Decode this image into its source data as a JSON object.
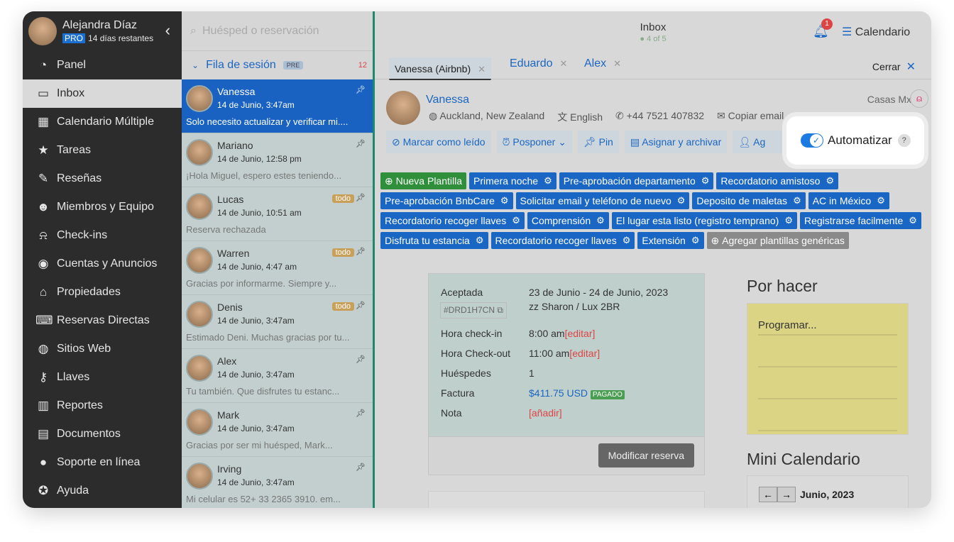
{
  "user": {
    "name": "Alejandra Díaz",
    "plan": "PRO",
    "trial": "14 días restantes"
  },
  "sidebar": {
    "items": [
      {
        "label": "Panel",
        "icon": "dashboard-icon",
        "glyph": "◔"
      },
      {
        "label": "Inbox",
        "icon": "inbox-icon",
        "glyph": "▭"
      },
      {
        "label": "Calendario Múltiple",
        "icon": "calendar-icon",
        "glyph": "▦"
      },
      {
        "label": "Tareas",
        "icon": "star-icon",
        "glyph": "★"
      },
      {
        "label": "Reseñas",
        "icon": "review-icon",
        "glyph": "✎"
      },
      {
        "label": "Miembros y Equipo",
        "icon": "team-icon",
        "glyph": "☻"
      },
      {
        "label": "Check-ins",
        "icon": "bell-icon",
        "glyph": "⍾"
      },
      {
        "label": "Cuentas y Anuncios",
        "icon": "account-icon",
        "glyph": "◉"
      },
      {
        "label": "Propiedades",
        "icon": "home-icon",
        "glyph": "⌂"
      },
      {
        "label": "Reservas Directas",
        "icon": "code-icon",
        "glyph": "⌨"
      },
      {
        "label": "Sitios Web",
        "icon": "globe-icon",
        "glyph": "◍"
      },
      {
        "label": "Llaves",
        "icon": "key-icon",
        "glyph": "⚷"
      },
      {
        "label": "Reportes",
        "icon": "chart-icon",
        "glyph": "▥"
      },
      {
        "label": "Documentos",
        "icon": "document-icon",
        "glyph": "▤"
      },
      {
        "label": "Soporte en línea",
        "icon": "chat-icon",
        "glyph": "●"
      },
      {
        "label": "Ayuda",
        "icon": "help-icon",
        "glyph": "✪"
      }
    ]
  },
  "search": {
    "placeholder": "Huésped o reservación"
  },
  "queue": {
    "label": "Fila de sesión",
    "tag": "PRE",
    "count": "12"
  },
  "conversations": [
    {
      "name": "Vanessa",
      "date": "14 de Junio, 3:47am",
      "preview": "Solo necesito actualizar y verificar mi....",
      "todo": ""
    },
    {
      "name": "Mariano",
      "date": "14 de Junio, 12:58 pm",
      "preview": "¡Hola Miguel, espero estes teniendo...",
      "todo": ""
    },
    {
      "name": "Lucas",
      "date": "14 de Junio, 10:51 am",
      "preview": "Reserva rechazada",
      "todo": "todo"
    },
    {
      "name": "Warren",
      "date": "14 de Junio, 4:47 am",
      "preview": "Gracias por informarme. Siempre y...",
      "todo": "todo"
    },
    {
      "name": "Denis",
      "date": "14 de Junio, 3:47am",
      "preview": "Estimado Deni. Muchas gracias por tu...",
      "todo": "todo"
    },
    {
      "name": "Alex",
      "date": "14 de Junio, 3:47am",
      "preview": "Tu también. Que disfrutes tu estanc...",
      "todo": ""
    },
    {
      "name": "Mark",
      "date": "14 de Junio, 3:47am",
      "preview": "Gracias por ser mi huésped, Mark...",
      "todo": ""
    },
    {
      "name": "Irving",
      "date": "14 de Junio, 3:47am",
      "preview": "Mi celular es 52+ 33 2365 3910. em...",
      "todo": ""
    }
  ],
  "header": {
    "title": "Inbox",
    "agents": "4 of 5",
    "notifications": "1",
    "calendar": "Calendario"
  },
  "tabs": [
    {
      "label": "Vanessa (Airbnb)"
    },
    {
      "label": "Eduardo"
    },
    {
      "label": "Alex"
    }
  ],
  "close_label": "Cerrar",
  "guest": {
    "name": "Vanessa",
    "location": "Auckland, New Zealand",
    "language": "English",
    "phone": "+44 7521 407832",
    "email": "Copiar email",
    "account": "Casas Mx"
  },
  "actions": [
    "Marcar como leído",
    "Posponer",
    "Pin",
    "Asignar y archivar",
    "Ag"
  ],
  "automate": {
    "label": "Automatizar",
    "enabled": true,
    "help": "?"
  },
  "templates": {
    "new": "Nueva Plantilla",
    "items": [
      "Primera noche",
      "Pre-aprobación departamento",
      "Recordatorio amistoso",
      "Pre-aprobación BnbCare",
      "Solicitar email y teléfono de nuevo",
      "Deposito de maletas",
      "AC in México",
      "Recordatorio recoger llaves",
      "Comprensión",
      "El lugar esta listo (registro temprano)",
      "Registrarse facilmente",
      "Disfruta tu estancia",
      "Recordatorio recoger llaves",
      "Extensión"
    ],
    "add_generic": "Agregar plantillas genéricas"
  },
  "reservation": {
    "status": "Aceptada",
    "dates": "23 de Junio - 24 de Junio, 2023",
    "code": "#DRD1H7CN",
    "listing": "zz Sharon / Lux 2BR",
    "checkin_label": "Hora check-in",
    "checkin": "8:00 am",
    "checkout_label": "Hora Check-out",
    "checkout": "11:00 am",
    "edit": "[editar]",
    "guests_label": "Huéspedes",
    "guests": "1",
    "invoice_label": "Factura",
    "invoice": "$411.75 USD",
    "paid": "PAGADO",
    "note_label": "Nota",
    "add": "[añadir]",
    "modify": "Modificar reserva"
  },
  "todo": {
    "title": "Por hacer",
    "first": "Programar..."
  },
  "mini_calendar": {
    "title": "Mini Calendario",
    "month": "Junio, 2023"
  }
}
